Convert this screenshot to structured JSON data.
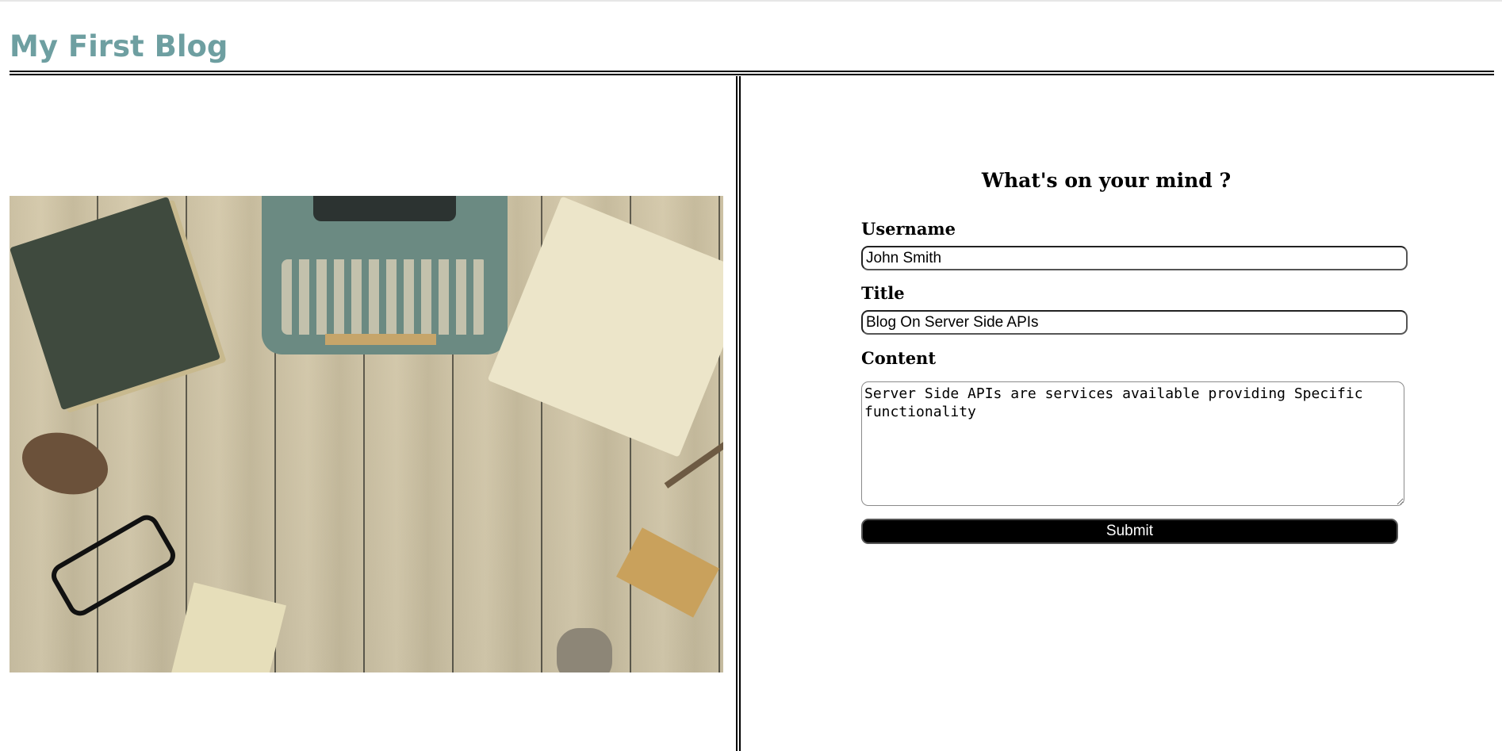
{
  "header": {
    "site_title": "My First Blog"
  },
  "form": {
    "heading": "What's on your mind ?",
    "username": {
      "label": "Username",
      "value": "John Smith"
    },
    "title": {
      "label": "Title",
      "value": "Blog On Server Side APIs"
    },
    "content": {
      "label": "Content",
      "value": "Server Side APIs are services available providing Specific functionality"
    },
    "submit_label": "Submit"
  },
  "colors": {
    "site_title": "#6e9fa1",
    "submit_background": "#000000"
  }
}
